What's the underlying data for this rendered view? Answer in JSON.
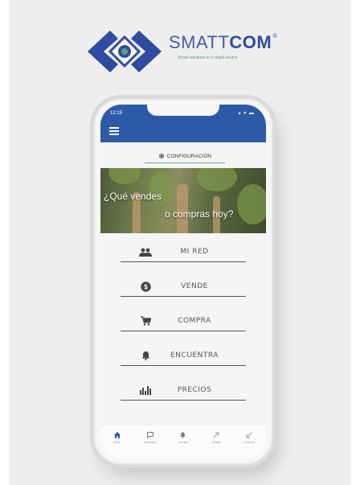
{
  "brand": {
    "name_light": "SMATT",
    "name_bold": "COM",
    "registered": "®",
    "tagline": "Smart solutions in a single source"
  },
  "status": {
    "time": "12:15"
  },
  "config": {
    "label": "CONFIGURACIÓN"
  },
  "banner": {
    "line1": "¿Qué vendes",
    "line2": "o compras hoy?"
  },
  "menu": [
    {
      "label": "MI RED",
      "icon": "people-icon"
    },
    {
      "label": "VENDE",
      "icon": "dollar-coin-icon"
    },
    {
      "label": "COMPRA",
      "icon": "cart-icon"
    },
    {
      "label": "ENCUENTRA",
      "icon": "bell-icon"
    },
    {
      "label": "PRECIOS",
      "icon": "bar-chart-icon"
    }
  ],
  "bottom_nav": [
    {
      "label": "Inicio",
      "icon": "home-icon"
    },
    {
      "label": "Mensajes",
      "icon": "message-icon"
    },
    {
      "label": "Alertas",
      "icon": "bell-icon"
    },
    {
      "label": "Ventas",
      "icon": "arrow-up-right-icon"
    },
    {
      "label": "Compras",
      "icon": "arrow-down-left-icon"
    }
  ],
  "colors": {
    "primary": "#2c5aa8",
    "accent": "#58b07a",
    "brand_text": "#3e5eb1"
  }
}
